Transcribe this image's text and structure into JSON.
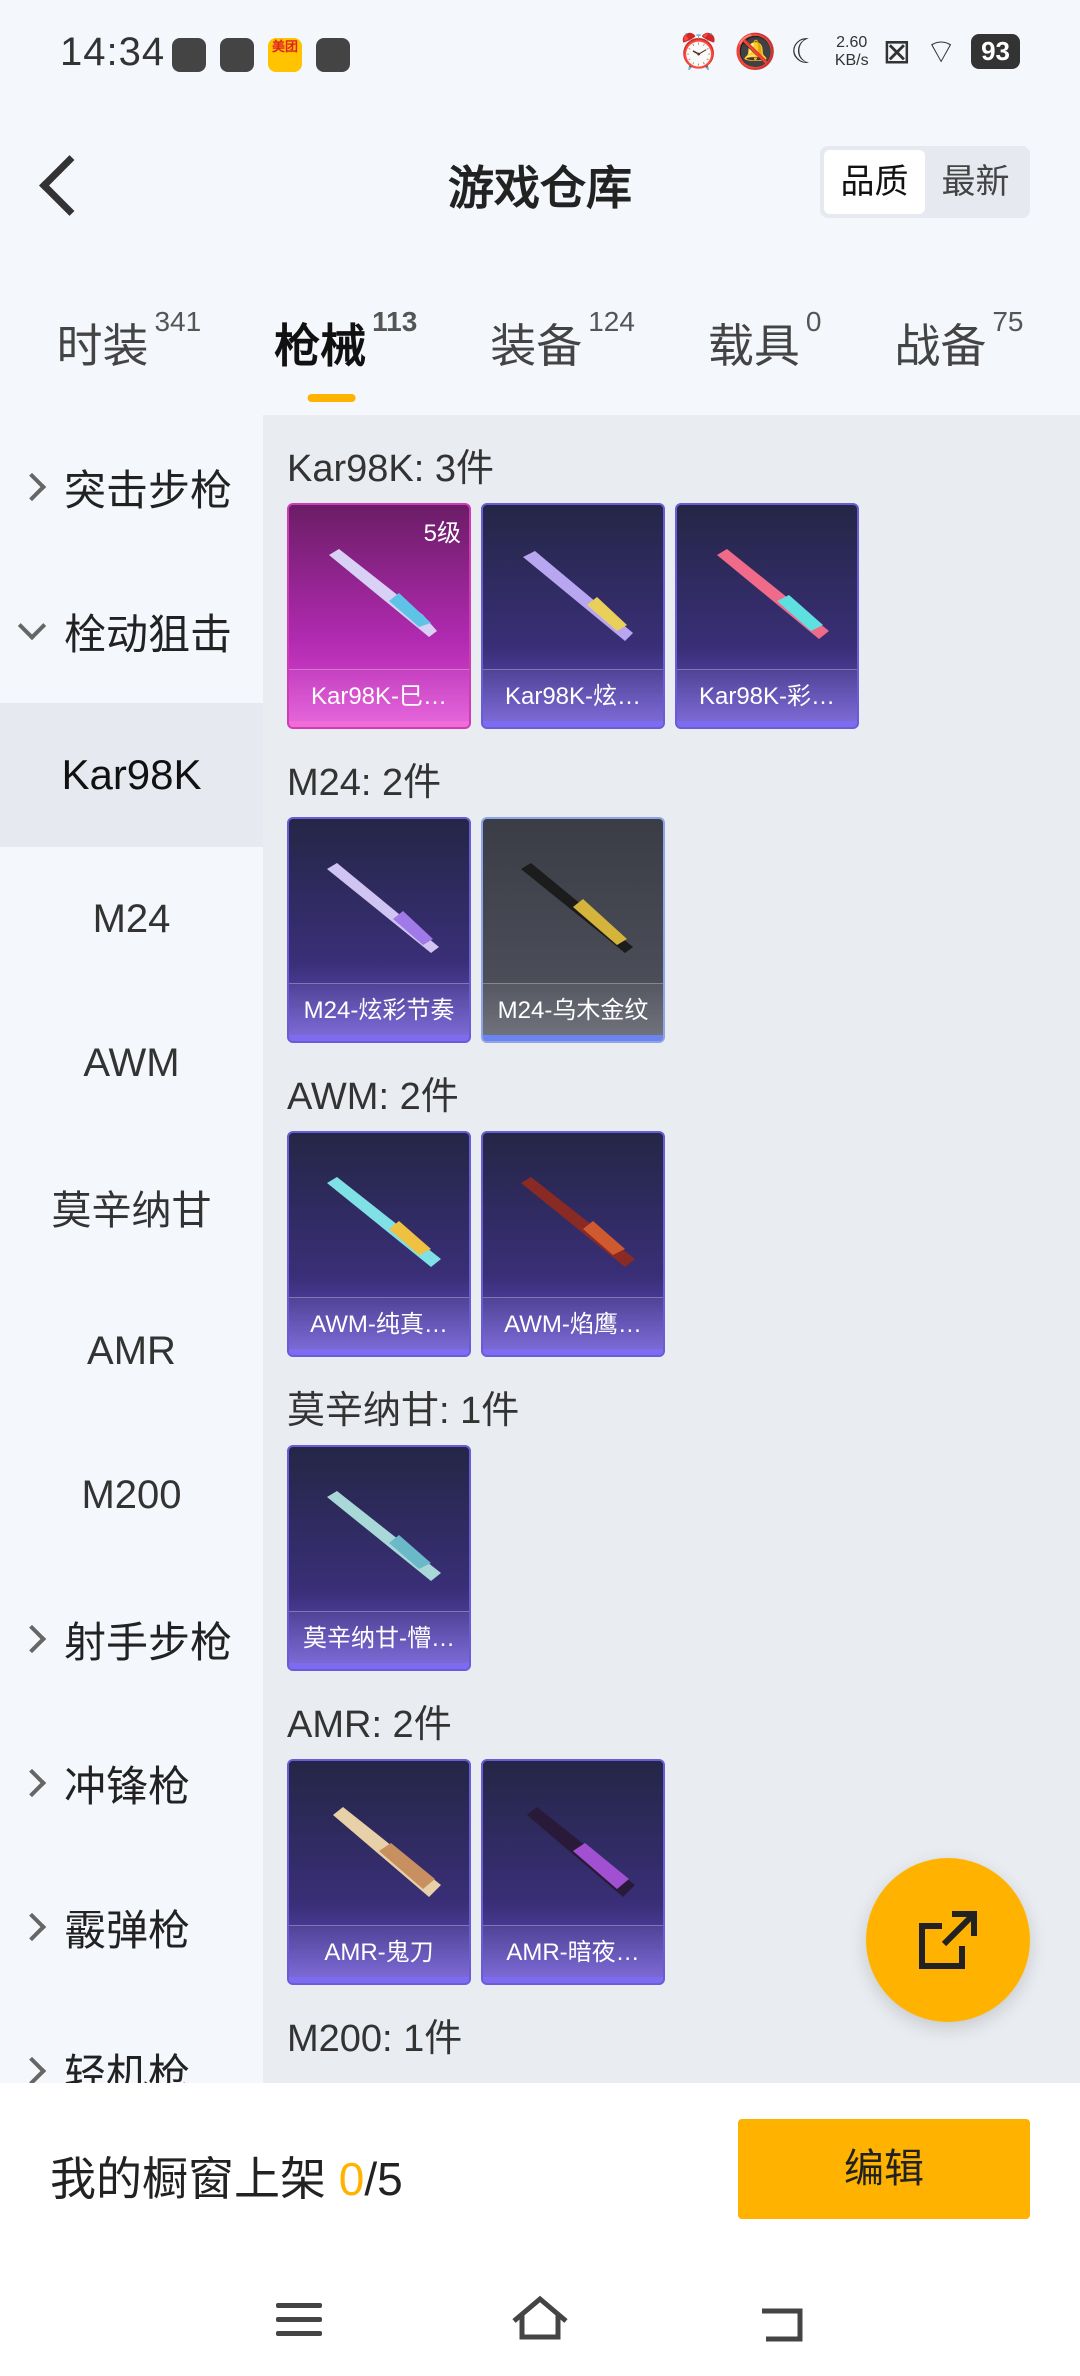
{
  "status_bar": {
    "time": "14:34",
    "left_icons": [
      "settings-icon",
      "tablet-icon",
      "meituan-icon",
      "bag-icon"
    ],
    "meituan_label": "美团",
    "net_speed_value": "2.60",
    "net_speed_unit": "KB/s",
    "battery": "93"
  },
  "header": {
    "title": "游戏仓库",
    "sort_options": [
      "品质",
      "最新"
    ],
    "active_sort": "品质"
  },
  "tabs": [
    {
      "label": "时装",
      "count": "341"
    },
    {
      "label": "枪械",
      "count": "113",
      "active": true
    },
    {
      "label": "装备",
      "count": "124"
    },
    {
      "label": "载具",
      "count": "0"
    },
    {
      "label": "战备",
      "count": "75"
    }
  ],
  "sidebar": {
    "categories": [
      {
        "label": "突击步枪"
      },
      {
        "label": "栓动狙击"
      },
      {
        "label": "射手步枪"
      },
      {
        "label": "冲锋枪"
      },
      {
        "label": "霰弹枪"
      },
      {
        "label": "轻机枪"
      }
    ],
    "subitems": [
      "Kar98K",
      "M24",
      "AWM",
      "莫辛纳甘",
      "AMR",
      "M200"
    ],
    "active_subitem": "Kar98K"
  },
  "groups": [
    {
      "title": "Kar98K: 3件",
      "items": [
        {
          "name": "Kar98K-巳…",
          "level": "5级",
          "rarity": "pink"
        },
        {
          "name": "Kar98K-炫…",
          "rarity": "purple"
        },
        {
          "name": "Kar98K-彩…",
          "rarity": "purple"
        }
      ]
    },
    {
      "title": "M24: 2件",
      "items": [
        {
          "name": "M24-炫彩节奏",
          "rarity": "purple"
        },
        {
          "name": "M24-乌木金纹",
          "rarity": "gray"
        }
      ]
    },
    {
      "title": "AWM: 2件",
      "items": [
        {
          "name": "AWM-纯真…",
          "rarity": "purple"
        },
        {
          "name": "AWM-焰鹰…",
          "rarity": "purple"
        }
      ]
    },
    {
      "title": "莫辛纳甘: 1件",
      "items": [
        {
          "name": "莫辛纳甘-懵…",
          "rarity": "purple"
        }
      ]
    },
    {
      "title": "AMR: 2件",
      "items": [
        {
          "name": "AMR-鬼刀",
          "rarity": "purple"
        },
        {
          "name": "AMR-暗夜…",
          "rarity": "purple"
        }
      ]
    },
    {
      "title": "M200: 1件",
      "items": []
    }
  ],
  "bottom_bar": {
    "shelf_prefix": "我的橱窗上架 ",
    "shelf_count": "0",
    "shelf_total": "/5",
    "edit_label": "编辑"
  },
  "colors": {
    "accent": "#ffb300",
    "pink_rarity": "#d23bb8",
    "purple_rarity": "#6a5cd6"
  }
}
